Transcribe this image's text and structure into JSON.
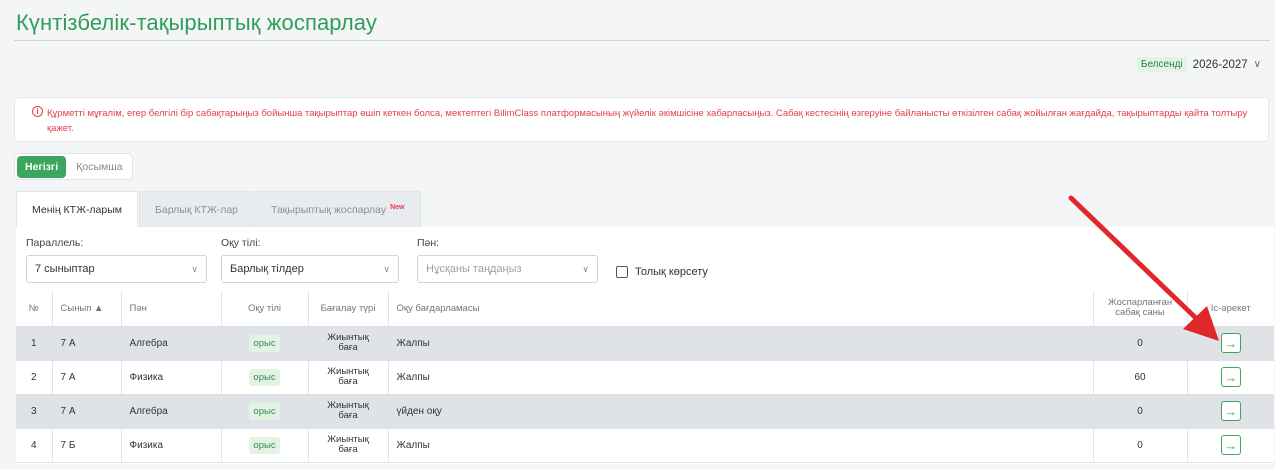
{
  "header": {
    "title": "Күнтізбелік-тақырыптық жоспарлау"
  },
  "year": {
    "badge": "Белсенді",
    "value": "2026-2027"
  },
  "alert": {
    "text": "Құрметті мұғалім, егер белгілі бір сабақтарыңыз бойынша тақырыптар өшіп кеткен болса, мектептегі BilimClass платформасының жүйелік әкімшісіне хабарласыңыз. Сабақ кестесінің өзгеруіне байланысты өткізілген сабақ жойылған жағдайда, тақырыптарды қайта толтыру қажет."
  },
  "segment": {
    "main": "Негізгі",
    "extra": "Қосымша"
  },
  "tabs": [
    {
      "label": "Менің КТЖ-ларым"
    },
    {
      "label": "Барлық КТЖ-лар"
    },
    {
      "label": "Тақырыптық жоспарлау",
      "badge": "New"
    }
  ],
  "filters": {
    "parallel_label": "Параллель:",
    "parallel_value": "7 сыныптар",
    "lang_label": "Оқу тілі:",
    "lang_value": "Барлық тілдер",
    "subject_label": "Пән:",
    "subject_placeholder": "Нұсқаны таңдаңыз",
    "full_show": "Толық көрсету"
  },
  "table": {
    "headers": {
      "num": "№",
      "class": "Сынып ▲",
      "subject": "Пән",
      "lang": "Оқу тілі",
      "eval": "Бағалау түрі",
      "program": "Оқу бағдарламасы",
      "planned": "Жоспарланған сабақ саны",
      "action": "Іс-әрекет"
    },
    "rows": [
      {
        "num": "1",
        "class": "7 А",
        "subject": "Алгебра",
        "lang": "орыс",
        "eval": "Жиынтық баға",
        "program": "Жалпы",
        "planned": "0"
      },
      {
        "num": "2",
        "class": "7 А",
        "subject": "Физика",
        "lang": "орыс",
        "eval": "Жиынтық баға",
        "program": "Жалпы",
        "planned": "60"
      },
      {
        "num": "3",
        "class": "7 А",
        "subject": "Алгебра",
        "lang": "орыс",
        "eval": "Жиынтық баға",
        "program": "үйден оқу",
        "planned": "0"
      },
      {
        "num": "4",
        "class": "7 Б",
        "subject": "Физика",
        "lang": "орыс",
        "eval": "Жиынтық баға",
        "program": "Жалпы",
        "planned": "0"
      }
    ]
  },
  "colors": {
    "accent": "#3aa65e",
    "alert": "#e23f4c",
    "annotation_arrow": "#e0282c"
  },
  "icons": {
    "row_action": "arrow-right-icon",
    "alert": "info-icon",
    "dropdown": "chevron-down-icon"
  }
}
